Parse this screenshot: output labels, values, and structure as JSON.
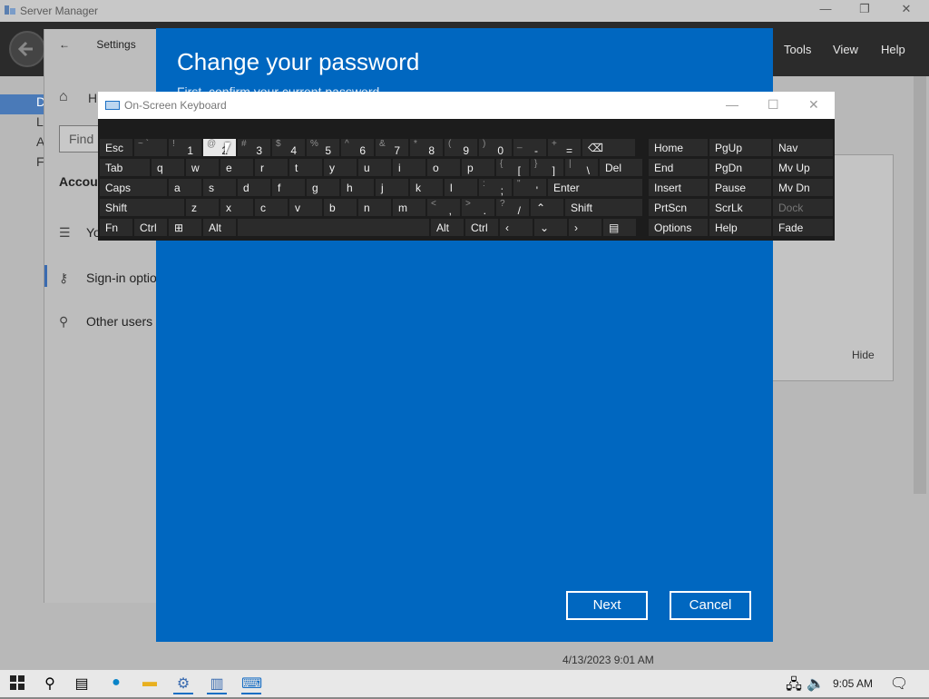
{
  "server_manager": {
    "title": "Server Manager",
    "menu": [
      "Tools",
      "View",
      "Help"
    ],
    "hide_label": "Hide",
    "date_text": "4/13/2023 9:01 AM"
  },
  "settings": {
    "title": "Settings",
    "home_label": "H",
    "search_placeholder": "Find",
    "section": "Accoun",
    "items": [
      {
        "label": "Yo",
        "icon": "person-card-icon"
      },
      {
        "label": "Sign-in optio",
        "icon": "key-icon"
      },
      {
        "label": "Other users",
        "icon": "person-add-icon"
      }
    ]
  },
  "dialog": {
    "title": "Change your password",
    "subtitle": "First, confirm your current password.",
    "next_label": "Next",
    "cancel_label": "Cancel"
  },
  "osk": {
    "title": "On-Screen Keyboard",
    "rows": [
      [
        {
          "main": "Esc",
          "shift": ""
        },
        {
          "main": "",
          "shift": "~ `"
        },
        {
          "main": "1",
          "shift": "!"
        },
        {
          "main": "2",
          "shift": "@",
          "highlight": true
        },
        {
          "main": "3",
          "shift": "#"
        },
        {
          "main": "4",
          "shift": "$"
        },
        {
          "main": "5",
          "shift": "%"
        },
        {
          "main": "6",
          "shift": "^"
        },
        {
          "main": "7",
          "shift": "&"
        },
        {
          "main": "8",
          "shift": "*"
        },
        {
          "main": "9",
          "shift": "("
        },
        {
          "main": "0",
          "shift": ")"
        },
        {
          "main": "-",
          "shift": "_"
        },
        {
          "main": "=",
          "shift": "+"
        },
        {
          "main": "⌫",
          "shift": ""
        }
      ],
      [
        {
          "main": "Tab",
          "shift": ""
        },
        {
          "main": "q",
          "shift": ""
        },
        {
          "main": "w",
          "shift": ""
        },
        {
          "main": "e",
          "shift": ""
        },
        {
          "main": "r",
          "shift": ""
        },
        {
          "main": "t",
          "shift": ""
        },
        {
          "main": "y",
          "shift": ""
        },
        {
          "main": "u",
          "shift": ""
        },
        {
          "main": "i",
          "shift": ""
        },
        {
          "main": "o",
          "shift": ""
        },
        {
          "main": "p",
          "shift": ""
        },
        {
          "main": "[",
          "shift": "{"
        },
        {
          "main": "]",
          "shift": "}"
        },
        {
          "main": "\\",
          "shift": "|"
        },
        {
          "main": "Del",
          "shift": ""
        }
      ],
      [
        {
          "main": "Caps",
          "shift": ""
        },
        {
          "main": "a",
          "shift": ""
        },
        {
          "main": "s",
          "shift": ""
        },
        {
          "main": "d",
          "shift": ""
        },
        {
          "main": "f",
          "shift": ""
        },
        {
          "main": "g",
          "shift": ""
        },
        {
          "main": "h",
          "shift": ""
        },
        {
          "main": "j",
          "shift": ""
        },
        {
          "main": "k",
          "shift": ""
        },
        {
          "main": "l",
          "shift": ""
        },
        {
          "main": ";",
          "shift": ":"
        },
        {
          "main": "'",
          "shift": "\""
        },
        {
          "main": "Enter",
          "shift": ""
        }
      ],
      [
        {
          "main": "Shift",
          "shift": ""
        },
        {
          "main": "z",
          "shift": ""
        },
        {
          "main": "x",
          "shift": ""
        },
        {
          "main": "c",
          "shift": ""
        },
        {
          "main": "v",
          "shift": ""
        },
        {
          "main": "b",
          "shift": ""
        },
        {
          "main": "n",
          "shift": ""
        },
        {
          "main": "m",
          "shift": ""
        },
        {
          "main": ",",
          "shift": "<"
        },
        {
          "main": ".",
          "shift": ">"
        },
        {
          "main": "/",
          "shift": "?"
        },
        {
          "main": "⌃",
          "shift": ""
        },
        {
          "main": "Shift",
          "shift": ""
        }
      ],
      [
        {
          "main": "Fn",
          "shift": ""
        },
        {
          "main": "Ctrl",
          "shift": ""
        },
        {
          "main": "⊞",
          "shift": ""
        },
        {
          "main": "Alt",
          "shift": ""
        },
        {
          "main": "",
          "shift": ""
        },
        {
          "main": "Alt",
          "shift": ""
        },
        {
          "main": "Ctrl",
          "shift": ""
        },
        {
          "main": "‹",
          "shift": ""
        },
        {
          "main": "⌄",
          "shift": ""
        },
        {
          "main": "›",
          "shift": ""
        },
        {
          "main": "▤",
          "shift": ""
        }
      ]
    ],
    "nav_rows": [
      [
        "Home",
        "PgUp",
        "Nav"
      ],
      [
        "End",
        "PgDn",
        "Mv Up"
      ],
      [
        "Insert",
        "Pause",
        "Mv Dn"
      ],
      [
        "PrtScn",
        "ScrLk",
        "Dock"
      ],
      [
        "Options",
        "Help",
        "Fade"
      ]
    ]
  },
  "taskbar": {
    "time": "9:05 AM",
    "icons": [
      "start-icon",
      "search-icon",
      "task-view-icon",
      "edge-icon",
      "file-explorer-icon",
      "settings-icon",
      "server-manager-icon",
      "osk-icon"
    ]
  }
}
